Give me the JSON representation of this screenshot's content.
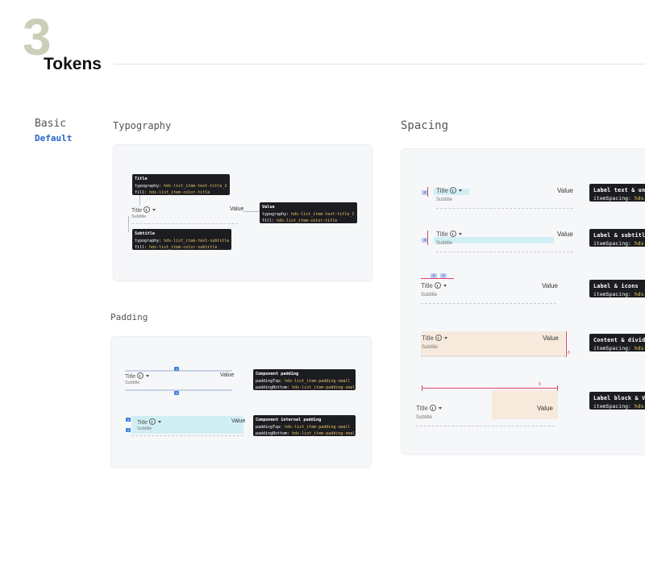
{
  "header": {
    "section_number": "3",
    "title": "Tokens"
  },
  "sidebar": {
    "label": "Basic",
    "sublabel": "Default"
  },
  "typography": {
    "heading": "Typography",
    "item": {
      "title": "Title",
      "subtitle": "Subtitle",
      "value": "Value"
    },
    "tips": [
      {
        "head": "Title",
        "lines": [
          {
            "key": "typography: ",
            "token": "hds-list_item-text-title_2"
          },
          {
            "key": "fill: ",
            "token": "hds-list_item-color-title"
          }
        ]
      },
      {
        "head": "Subtitle",
        "lines": [
          {
            "key": "typography: ",
            "token": "hds-list_item-text-subtitle"
          },
          {
            "key": "fill: ",
            "token": "hds-list_item-color-subtitle"
          }
        ]
      },
      {
        "head": "Value",
        "lines": [
          {
            "key": "typography: ",
            "token": "hds-list_item-text-title_1"
          },
          {
            "key": "fill: ",
            "token": "hds-list_item-color-title"
          }
        ]
      }
    ]
  },
  "padding": {
    "heading": "Padding",
    "item": {
      "title": "Title",
      "subtitle": "Subtitle",
      "value": "Value"
    },
    "badge": "4",
    "tips": [
      {
        "head": "Component padding",
        "lines": [
          {
            "key": "paddingTop: ",
            "token": "hds-list_item-padding-small"
          },
          {
            "key": "paddingBottom: ",
            "token": "hds-list_item-padding-small"
          }
        ]
      },
      {
        "head": "Component internal padding",
        "lines": [
          {
            "key": "paddingTop: ",
            "token": "hds-list_item-padding-small"
          },
          {
            "key": "paddingBottom: ",
            "token": "hds-list_item-padding-small"
          }
        ]
      }
    ]
  },
  "spacing": {
    "heading": "Spacing",
    "item": {
      "title": "Title",
      "subtitle": "Subtitle",
      "value": "Value"
    },
    "badges": {
      "small": "4",
      "large": "8"
    },
    "tips": [
      {
        "head": "Label text & under",
        "key": "itemSpacing: ",
        "token": "hds-l"
      },
      {
        "head": "Label & subtitle",
        "key": "itemSpacing: ",
        "token": "hds-l"
      },
      {
        "head": "Label & icons",
        "key": "itemSpacing: ",
        "token": "hds-l"
      },
      {
        "head": "Content & divider",
        "key": "itemSpacing: ",
        "token": "hds-l"
      },
      {
        "head": "Label block & Valu",
        "key": "itemSpacing: ",
        "token": "hds-l"
      }
    ]
  }
}
